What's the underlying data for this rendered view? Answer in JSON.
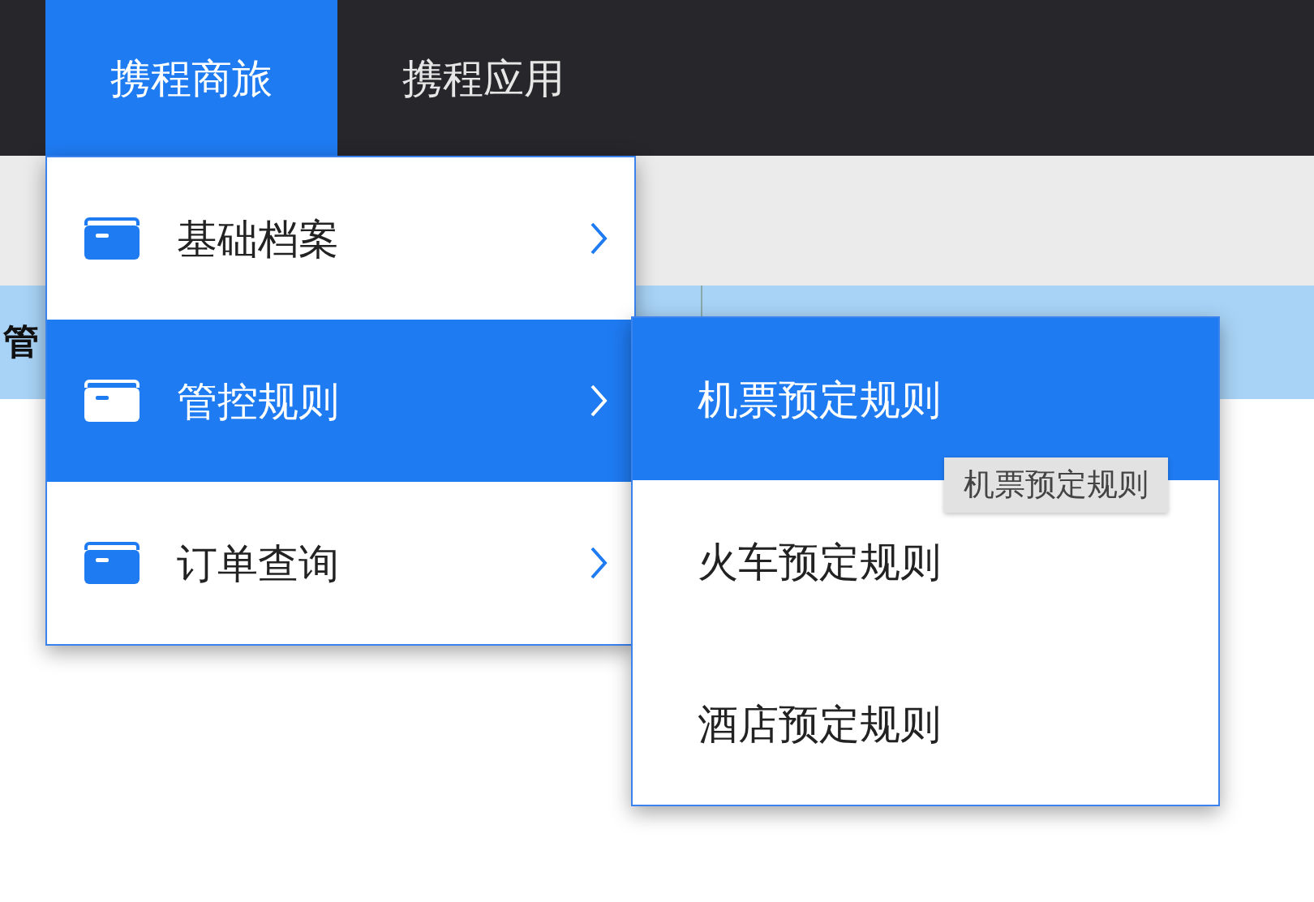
{
  "nav_tabs": [
    {
      "label": "携程商旅",
      "selected": true
    },
    {
      "label": "携程应用",
      "selected": false
    }
  ],
  "table_header": {
    "column_1": "管"
  },
  "menu": {
    "items": [
      {
        "label": "基础档案",
        "selected": false,
        "has_submenu": true
      },
      {
        "label": "管控规则",
        "selected": true,
        "has_submenu": true
      },
      {
        "label": "订单查询",
        "selected": false,
        "has_submenu": true
      }
    ]
  },
  "submenu": {
    "items": [
      {
        "label": "机票预定规则",
        "selected": true
      },
      {
        "label": "火车预定规则",
        "selected": false
      },
      {
        "label": "酒店预定规则",
        "selected": false
      }
    ]
  },
  "tooltip": "机票预定规则"
}
